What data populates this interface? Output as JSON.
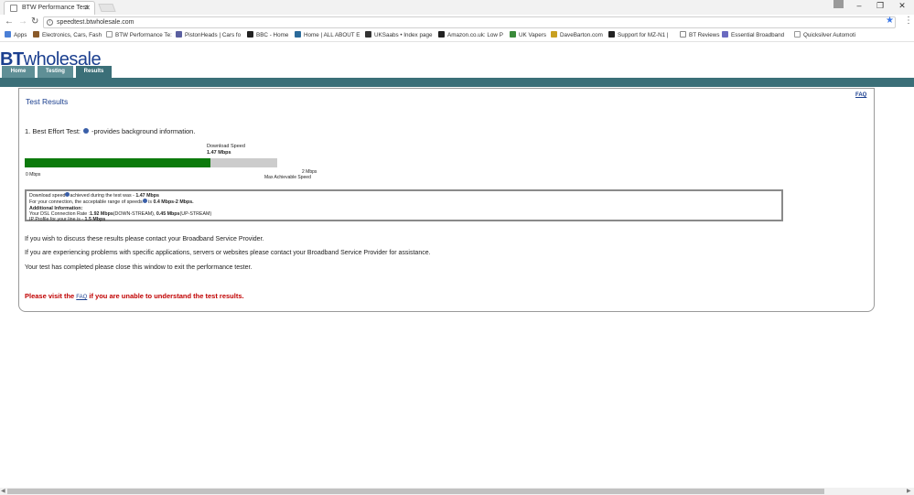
{
  "browser": {
    "tab_title": "BTW Performance Test",
    "url": "speedtest.btwholesale.com",
    "bookmarks": [
      {
        "label": "Apps",
        "color": "#4a7fd6"
      },
      {
        "label": "Electronics, Cars, Fash",
        "color": "#8a5a2a"
      },
      {
        "label": "BTW Performance Te:",
        "color": "#999999"
      },
      {
        "label": "PistonHeads | Cars fo",
        "color": "#5a5fa0"
      },
      {
        "label": "BBC - Home",
        "color": "#222222"
      },
      {
        "label": "Home | ALL ABOUT E",
        "color": "#2a6a9a"
      },
      {
        "label": "UKSaabs • Index page",
        "color": "#333333"
      },
      {
        "label": "Amazon.co.uk: Low P",
        "color": "#222222"
      },
      {
        "label": "UK Vapers",
        "color": "#3a8a3a"
      },
      {
        "label": "DaveBarton.com",
        "color": "#c8a020"
      },
      {
        "label": "Support for MZ-N1 |",
        "color": "#222222"
      },
      {
        "label": "BT Reviews",
        "color": "#888888"
      },
      {
        "label": "Essential Broadband",
        "color": "#6a6ac0"
      },
      {
        "label": "Quicksilver Automoti",
        "color": "#999999"
      }
    ]
  },
  "header": {
    "logo_bt": "BT",
    "logo_wholesale": "wholesale",
    "tabs": [
      {
        "label": "Home"
      },
      {
        "label": "Testing"
      },
      {
        "label": "Results"
      }
    ]
  },
  "results": {
    "title": "Test Results",
    "faq_link": "FAQ",
    "best_effort_label": "1. Best Effort Test:",
    "best_effort_suffix": "-provides background information.",
    "download_label": "Download  Speed",
    "download_value": "1.47 Mbps",
    "bar_fraction": 0.735,
    "bar_min": "0 Mbps",
    "bar_max": "2 Mbps",
    "bar_max_label": "Max Achievable Speed",
    "info": {
      "line1_prefix": "Download speed",
      "line1_mid": "achieved during the test was - ",
      "line1_value": "1.47 Mbps",
      "line2_prefix": "For your connection, the acceptable range of speeds",
      "line2_mid": " is ",
      "line2_value": "0.4 Mbps-2 Mbps.",
      "line3": "Additional Information:",
      "line4_prefix": "Your DSL Connection Rate :",
      "line4_down": "1.92 Mbps",
      "line4_down_suffix": "(DOWN-STREAM), ",
      "line4_up": "0.45 Mbps",
      "line4_up_suffix": "(UP-STREAM)",
      "line5_prefix": "IP Profile for your line is - ",
      "line5_value": "1.5 Mbps"
    },
    "messages": [
      "If you wish to discuss these results please contact your Broadband Service Provider.",
      "If you are experiencing problems with specific applications, servers or websites please contact your Broadband Service Provider for assistance.",
      "Your test has completed please close this window to exit the performance tester."
    ],
    "visit_prefix": "Please visit the ",
    "visit_link": "FAQ",
    "visit_suffix": " if you are unable to understand the test results."
  },
  "colors": {
    "bt_blue": "#1b3f8f",
    "nav_teal": "#3b6f78",
    "bar_green": "#0c7a0c",
    "warning_red": "#c00000"
  }
}
